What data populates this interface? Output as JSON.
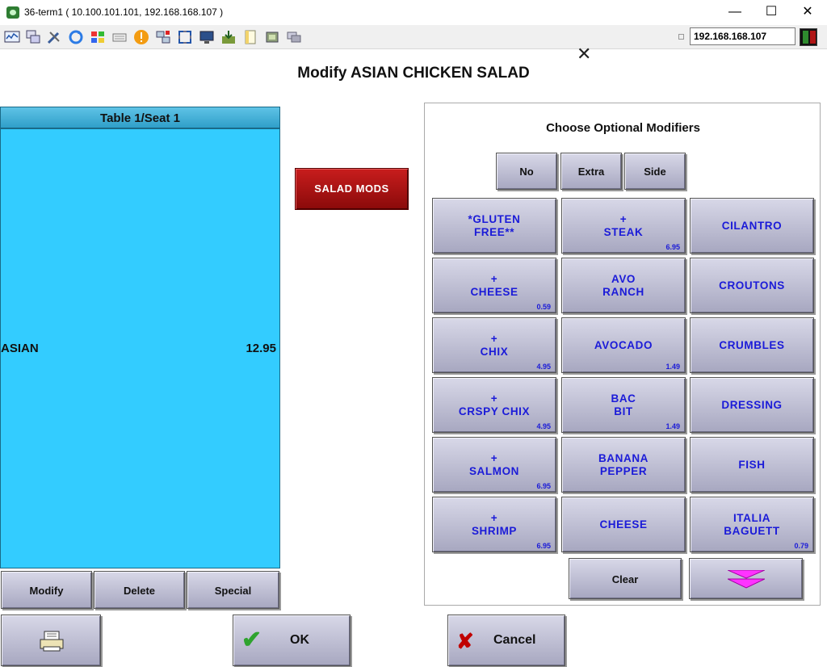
{
  "window": {
    "title": "36-term1 ( 10.100.101.101, 192.168.168.107 )"
  },
  "toolbar": {
    "address": "192.168.168.107"
  },
  "page": {
    "title": "Modify ASIAN CHICKEN SALAD"
  },
  "seat_panel": {
    "header": "Table 1/Seat 1",
    "item": {
      "name": "ASIAN",
      "price": "12.95"
    },
    "buttons": [
      "Modify",
      "Delete",
      "Special"
    ]
  },
  "salad_mods_label": "SALAD MODS",
  "modifiers": {
    "title": "Choose Optional Modifiers",
    "options": [
      "No",
      "Extra",
      "Side"
    ],
    "grid": [
      {
        "lines": [
          "*GLUTEN",
          "FREE**"
        ],
        "price": ""
      },
      {
        "lines": [
          "+",
          "STEAK"
        ],
        "price": "6.95"
      },
      {
        "lines": [
          "CILANTRO"
        ],
        "price": ""
      },
      {
        "lines": [
          "+",
          "CHEESE"
        ],
        "price": "0.59"
      },
      {
        "lines": [
          "AVO",
          "RANCH"
        ],
        "price": ""
      },
      {
        "lines": [
          "CROUTONS"
        ],
        "price": ""
      },
      {
        "lines": [
          "+",
          "CHIX"
        ],
        "price": "4.95"
      },
      {
        "lines": [
          "AVOCADO"
        ],
        "price": "1.49"
      },
      {
        "lines": [
          "CRUMBLES"
        ],
        "price": ""
      },
      {
        "lines": [
          "+",
          "CRSPY CHIX"
        ],
        "price": "4.95"
      },
      {
        "lines": [
          "BAC",
          "BIT"
        ],
        "price": "1.49"
      },
      {
        "lines": [
          "DRESSING"
        ],
        "price": ""
      },
      {
        "lines": [
          "+",
          "SALMON"
        ],
        "price": "6.95"
      },
      {
        "lines": [
          "BANANA",
          "PEPPER"
        ],
        "price": ""
      },
      {
        "lines": [
          "FISH"
        ],
        "price": ""
      },
      {
        "lines": [
          "+",
          "SHRIMP"
        ],
        "price": "6.95"
      },
      {
        "lines": [
          "CHEESE"
        ],
        "price": ""
      },
      {
        "lines": [
          "ITALIA",
          "BAGUETT"
        ],
        "price": "0.79"
      }
    ],
    "clear_label": "Clear"
  },
  "bottom": {
    "ok_label": "OK",
    "cancel_label": "Cancel"
  },
  "colors": {
    "seat_panel_bg": "#33ccff",
    "salad_mods_bg": "#b01515",
    "modifier_text": "#1b1bd8",
    "page_down_arrow": "#ff33ff"
  }
}
